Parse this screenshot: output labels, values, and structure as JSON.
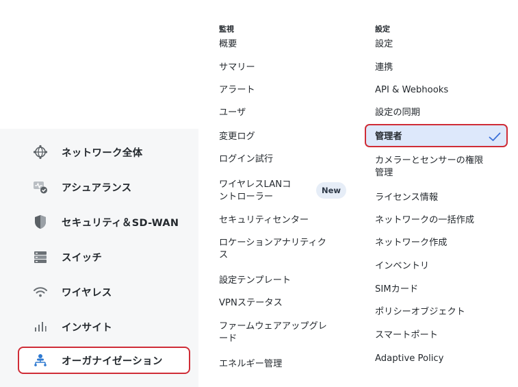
{
  "sidebar": {
    "items": [
      {
        "label": "ネットワーク全体",
        "icon": "network-globe-icon"
      },
      {
        "label": "アシュアランス",
        "icon": "assurance-monitor-icon"
      },
      {
        "label": "セキュリティ＆SD-WAN",
        "icon": "shield-icon"
      },
      {
        "label": "スイッチ",
        "icon": "switch-icon"
      },
      {
        "label": "ワイヤレス",
        "icon": "wifi-icon"
      },
      {
        "label": "インサイト",
        "icon": "bar-chart-icon"
      },
      {
        "label": "オーガナイゼーション",
        "icon": "organization-icon",
        "active": true
      }
    ]
  },
  "menu": {
    "monitor": {
      "heading": "監視",
      "items": [
        "概要",
        "サマリー",
        "アラート",
        "ユーザ",
        "変更ログ",
        "ログイン試行",
        "ワイヤレスLANコ\nントローラー",
        "セキュリティセンター",
        "ロケーションアナリティク\nス",
        "設定テンプレート",
        "VPNステータス",
        "ファームウェアアップグレ\nード",
        "エネルギー管理"
      ],
      "badge": "New"
    },
    "settings": {
      "heading": "設定",
      "items": [
        "設定",
        "連携",
        "API & Webhooks",
        "設定の同期",
        "管理者",
        "カメラーとセンサーの権限\n管理",
        "ライセンス情報",
        "ネットワークの一括作成",
        "ネットワーク作成",
        "インベントリ",
        "SIMカード",
        "ポリシーオブジェクト",
        "スマートポート",
        "Adaptive Policy"
      ],
      "selected_index": 4
    }
  },
  "colors": {
    "accent_red": "#cf2c36",
    "selected_bg": "#dde8fb",
    "check_blue": "#3a6fd8",
    "org_icon_blue": "#2f7ad1"
  }
}
